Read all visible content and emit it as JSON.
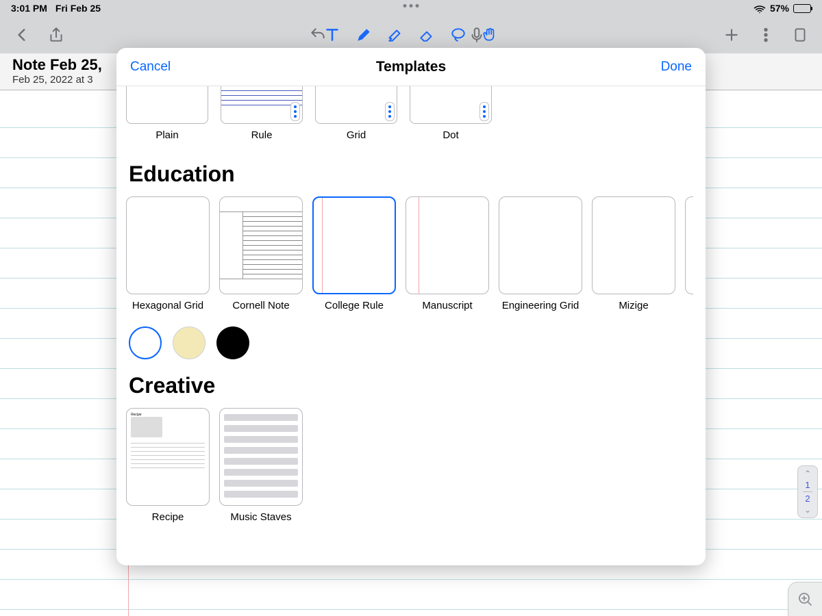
{
  "status": {
    "time": "3:01 PM",
    "date": "Fri Feb 25",
    "battery_pct": "57%"
  },
  "note": {
    "title": "Note Feb 25,",
    "subtitle": "Feb 25, 2022 at 3"
  },
  "modal": {
    "cancel": "Cancel",
    "title": "Templates",
    "done": "Done",
    "basic": [
      {
        "label": "Plain"
      },
      {
        "label": "Rule"
      },
      {
        "label": "Grid"
      },
      {
        "label": "Dot"
      }
    ],
    "section_education": "Education",
    "education": [
      {
        "label": "Hexagonal Grid"
      },
      {
        "label": "Cornell Note"
      },
      {
        "label": "College Rule",
        "selected": true
      },
      {
        "label": "Manuscript"
      },
      {
        "label": "Engineering Grid"
      },
      {
        "label": "Mizige"
      }
    ],
    "colors": [
      {
        "name": "white",
        "selected": true
      },
      {
        "name": "cream"
      },
      {
        "name": "black"
      }
    ],
    "section_creative": "Creative",
    "creative": [
      {
        "label": "Recipe"
      },
      {
        "label": "Music Staves"
      }
    ]
  },
  "page_indicator": {
    "current": "1",
    "total": "2"
  }
}
